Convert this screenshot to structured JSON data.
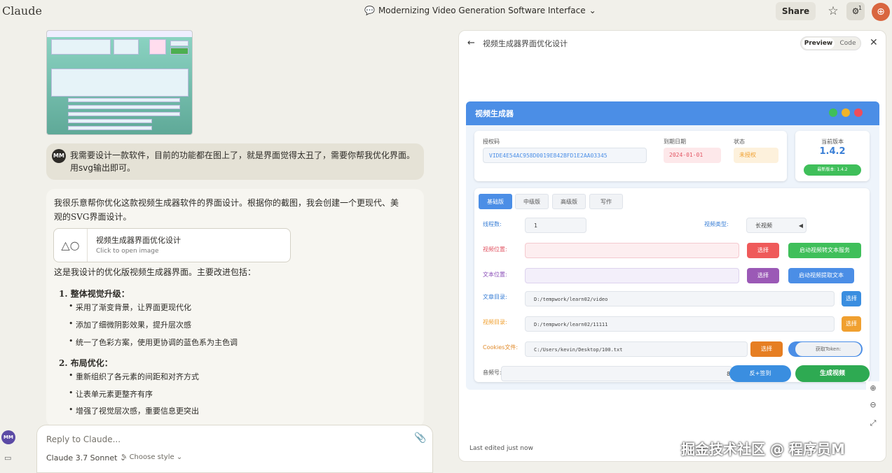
{
  "app": {
    "name": "Claude"
  },
  "header": {
    "title": "Modernizing Video Generation Software Interface",
    "share_label": "Share",
    "badge_count": "1"
  },
  "user_message": {
    "initials": "MM",
    "text": "我需要设计一款软件，目前的功能都在图上了，就是界面觉得太丑了，需要你帮我优化界面。用svg输出即可。"
  },
  "response": {
    "intro": "我很乐意帮你优化这款视频生成器软件的界面设计。根据你的截图，我会创建一个更现代、美观的SVG界面设计。",
    "artifact_title": "视频生成器界面优化设计",
    "artifact_sub": "Click to open image",
    "p2": "这是我设计的优化版视频生成器界面。主要改进包括：",
    "sections": [
      {
        "title": "1. 整体视觉升级：",
        "items": [
          "采用了渐变背景，让界面更现代化",
          "添加了细微阴影效果，提升层次感",
          "统一了色彩方案，使用更协调的蓝色系为主色调"
        ]
      },
      {
        "title": "2. 布局优化：",
        "items": [
          "重新组织了各元素的间距和对齐方式",
          "让表单元素更整齐有序",
          "增强了视觉层次感，重要信息更突出"
        ]
      }
    ]
  },
  "composer": {
    "placeholder": "Reply to Claude...",
    "model": "Claude 3.7 Sonnet",
    "style": "Choose style",
    "avatar": "MM"
  },
  "panel": {
    "title": "视频生成器界面优化设计",
    "preview_label": "Preview",
    "code_label": "Code",
    "last_edited": "Last edited just now",
    "mock": {
      "title": "视频生成器",
      "auth_label": "授权码",
      "auth_code": "VIDE4E54AC958D0019E842BFD1E2AA03345",
      "expire_label": "到期日期",
      "expire_value": "2024-01-01",
      "status_label": "状态",
      "status_value": "未授权",
      "version_label": "当前版本",
      "version_value": "1.4.2",
      "latest_label": "最新版本: 1.4.2",
      "tabs": [
        "基础版",
        "中级版",
        "高级版",
        "写作"
      ],
      "thread_label": "线程数:",
      "thread_value": "1",
      "type_label": "视频类型:",
      "type_value": "长视频",
      "video_pos_label": "视频位置:",
      "select_label": "选择",
      "start_video_text": "启动视频转文本服务",
      "text_pos_label": "文本位置:",
      "start_extract": "启动视频提取文本",
      "text_dir_label": "文章目录:",
      "text_dir": "D:/tempwork/learn02/video",
      "video_dir_label": "视频目录:",
      "video_dir": "D:/tempwork/learn02/11111",
      "cookies_label": "Cookies文件:",
      "cookies_path": "C:/Users/kevin/Desktop/100.txt",
      "token_label": "获取Token:",
      "audio_label": "音频号:",
      "audio_tail": "8",
      "rebuild_label": "反+签到",
      "generate_label": "生成视频"
    }
  },
  "watermark": "掘金技术社区 @ 程序员M"
}
